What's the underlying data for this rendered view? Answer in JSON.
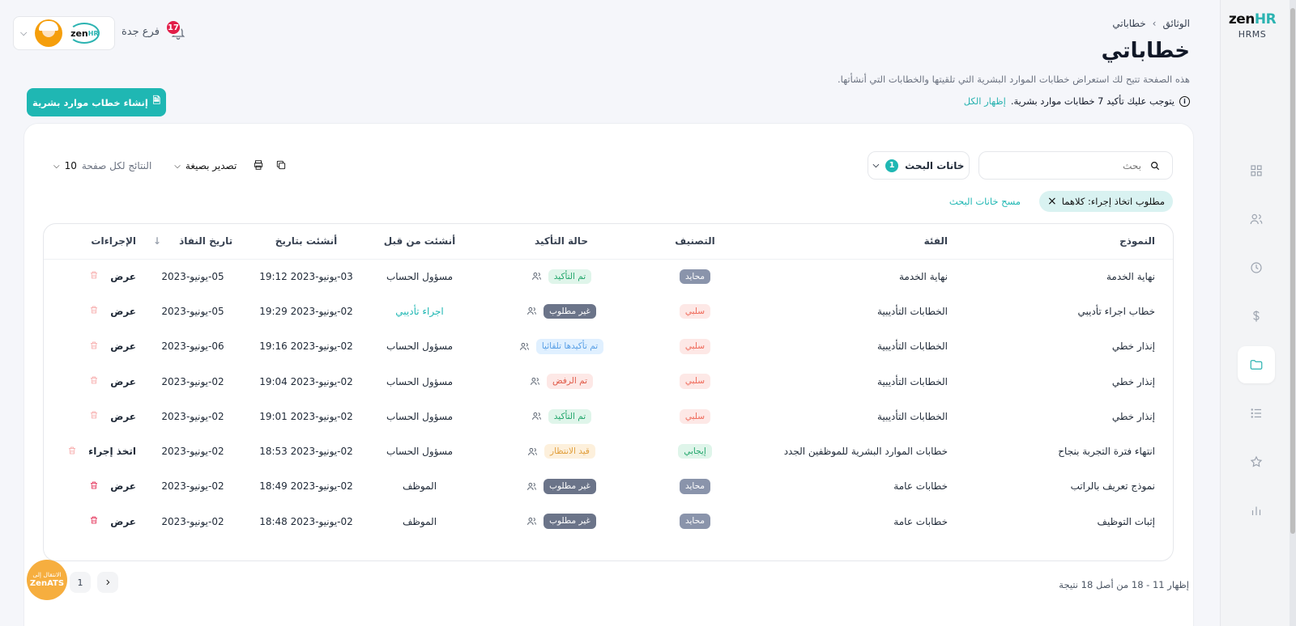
{
  "sidebar": {
    "logo_main": "zen",
    "logo_hr": "HR",
    "logo_sub": "HRMS"
  },
  "breadcrumb": {
    "root": "الوثائق",
    "current": "خطاباتي"
  },
  "page": {
    "title": "خطاباتي",
    "description": "هذه الصفحة تتيح لك استعراض خطابات الموارد البشرية التي تلقيتها والخطابات التي أنشأتها.",
    "notice_text": "يتوجب عليك تأكيد 7 خطابات موارد بشرية.",
    "notice_link": "إظهار الكل",
    "create_button": "إنشاء خطاب موارد بشرية"
  },
  "header": {
    "branch": "فرع جدة",
    "notifications_count": "17",
    "company_logo_main": "zen",
    "company_logo_hr": "HR"
  },
  "search": {
    "placeholder": "بحث"
  },
  "filters": {
    "label": "خانات البحث",
    "count": "1"
  },
  "toolbar": {
    "export_label": "تصدير بصيغة",
    "per_page_label": "النتائج لكل صفحة",
    "per_page_value": "10"
  },
  "active_filter": {
    "label": "مطلوب اتخاذ إجراء: كلاهما",
    "clear_label": "مسح خانات البحث"
  },
  "table": {
    "headers": {
      "model": "النموذج",
      "category": "الفئة",
      "classification": "التصنيف",
      "status": "حالة التأكيد",
      "created_by": "أنشئت من قبل",
      "created_at": "أنشئت بتاريخ",
      "effective_date": "تاريخ النفاذ",
      "actions": "الإجراءات"
    },
    "rows": [
      {
        "model": "نهاية الخدمة",
        "category": "نهاية الخدمة",
        "classification": "محايد",
        "status": "تم التأكيد",
        "created_by": "مسؤول الحساب",
        "created_at": "03-يونيو-2023 19:12",
        "effective_date": "05-يونيو-2023",
        "action": "عرض"
      },
      {
        "model": "خطاب اجراء تأديبي",
        "category": "الخطابات التأديبية",
        "classification": "سلبي",
        "status": "غير مطلوب",
        "created_by": "اجراء تأديبي",
        "created_at": "02-يونيو-2023 19:29",
        "effective_date": "05-يونيو-2023",
        "action": "عرض"
      },
      {
        "model": "إنذار خطي",
        "category": "الخطابات التأديبية",
        "classification": "سلبي",
        "status": "تم تأكيدها تلقائيا",
        "created_by": "مسؤول الحساب",
        "created_at": "02-يونيو-2023 19:16",
        "effective_date": "06-يونيو-2023",
        "action": "عرض"
      },
      {
        "model": "إنذار خطي",
        "category": "الخطابات التأديبية",
        "classification": "سلبي",
        "status": "تم الرفض",
        "created_by": "مسؤول الحساب",
        "created_at": "02-يونيو-2023 19:04",
        "effective_date": "02-يونيو-2023",
        "action": "عرض"
      },
      {
        "model": "إنذار خطي",
        "category": "الخطابات التأديبية",
        "classification": "سلبي",
        "status": "تم التأكيد",
        "created_by": "مسؤول الحساب",
        "created_at": "02-يونيو-2023 19:01",
        "effective_date": "02-يونيو-2023",
        "action": "عرض"
      },
      {
        "model": "انتهاء فترة التجربة بنجاح",
        "category": "خطابات الموارد البشرية للموظفين الجدد",
        "classification": "إيجابي",
        "status": "قيد الانتظار",
        "created_by": "مسؤول الحساب",
        "created_at": "02-يونيو-2023 18:53",
        "effective_date": "02-يونيو-2023",
        "action": "اتخذ إجراء"
      },
      {
        "model": "نموذج تعريف بالراتب",
        "category": "خطابات عامة",
        "classification": "محايد",
        "status": "غير مطلوب",
        "created_by": "الموظف",
        "created_at": "02-يونيو-2023 18:49",
        "effective_date": "02-يونيو-2023",
        "action": "عرض"
      },
      {
        "model": "إثبات التوظيف",
        "category": "خطابات عامة",
        "classification": "محايد",
        "status": "غير مطلوب",
        "created_by": "الموظف",
        "created_at": "02-يونيو-2023 18:48",
        "effective_date": "02-يونيو-2023",
        "action": "عرض"
      }
    ]
  },
  "pagination": {
    "page": "1",
    "results_text": "إظهار 11 - 18 من أصل 18 نتيجة"
  },
  "ats": {
    "line1": "الانتقال إلى",
    "line2": "ZenATS"
  },
  "colors": {
    "accent": "#1fb7b3",
    "danger": "#e11d48",
    "warning": "#f6ae3f"
  }
}
